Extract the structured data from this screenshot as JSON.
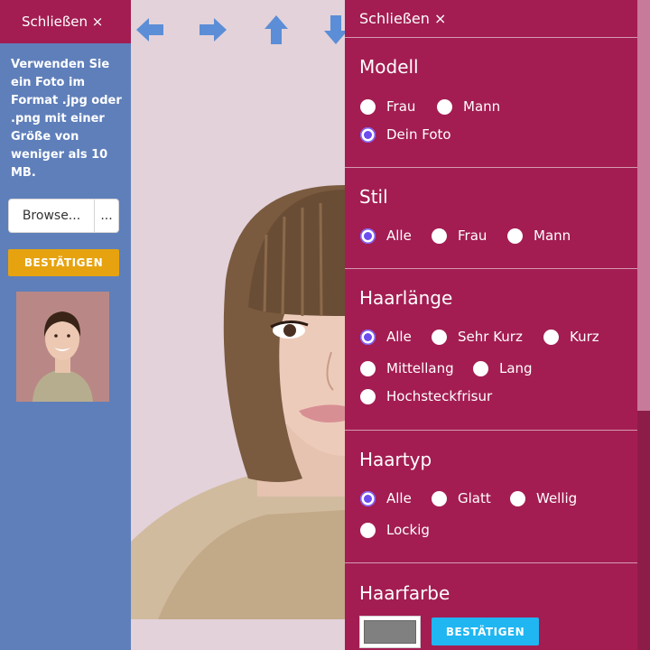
{
  "left_panel": {
    "close_label": "Schließen ×",
    "info_text": "Verwenden Sie ein Foto im Format .jpg oder .png mit einer Größe von weniger als 10 MB.",
    "browse_label": "Browse...",
    "browse_more_label": "...",
    "confirm_label": "BESTÄTIGEN"
  },
  "toolbar": {
    "arrows": [
      "arrow-left-icon",
      "arrow-right-icon",
      "arrow-up-icon",
      "arrow-down-icon"
    ],
    "arrow_color": "#5b8ed6"
  },
  "right_panel": {
    "close_label": "Schließen ×",
    "modell": {
      "title": "Modell",
      "options": [
        "Frau",
        "Mann",
        "Dein Foto"
      ],
      "selected": "Dein Foto"
    },
    "stil": {
      "title": "Stil",
      "options": [
        "Alle",
        "Frau",
        "Mann"
      ],
      "selected": "Alle"
    },
    "haarlaenge": {
      "title": "Haarlänge",
      "options": [
        "Alle",
        "Sehr Kurz",
        "Kurz",
        "Mittellang",
        "Lang",
        "Hochsteckfrisur"
      ],
      "selected": "Alle"
    },
    "haartyp": {
      "title": "Haartyp",
      "options": [
        "Alle",
        "Glatt",
        "Wellig",
        "Lockig"
      ],
      "selected": "Alle"
    },
    "haarfarbe": {
      "title": "Haarfarbe",
      "swatch_color": "#808080",
      "confirm_label": "BESTÄTIGEN"
    }
  },
  "colors": {
    "accent": "#a31d52",
    "left_panel_bg": "#5f7fba",
    "left_confirm": "#e6a30f",
    "right_confirm": "#1fb6f2",
    "radio_selected": "#6c4df0"
  }
}
